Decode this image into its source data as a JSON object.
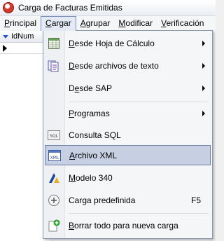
{
  "window": {
    "title": "Carga de Facturas Emitidas"
  },
  "menubar": [
    {
      "label": "Principal"
    },
    {
      "label": "Cargar"
    },
    {
      "label": "Agrupar"
    },
    {
      "label": "Modificar"
    },
    {
      "label": "Verificación"
    }
  ],
  "grid": {
    "column_header": "IdNum"
  },
  "menu": {
    "items": [
      {
        "pre": "",
        "u": "D",
        "post": "esde Hoja de Cálculo",
        "icon": "spreadsheet-icon",
        "has_submenu": true
      },
      {
        "pre": "",
        "u": "D",
        "post": "esde archivos de texto",
        "icon": "text-files-icon",
        "has_submenu": true
      },
      {
        "pre": "D",
        "u": "e",
        "post": "sde SAP",
        "icon": "",
        "has_submenu": true
      },
      {
        "pre": "",
        "u": "P",
        "post": "rogramas",
        "icon": "",
        "has_submenu": true
      },
      {
        "pre": "Consulta SQL",
        "u": "",
        "post": "",
        "icon": "sql-icon",
        "has_submenu": false
      },
      {
        "pre": "",
        "u": "A",
        "post": "rchivo XML",
        "icon": "xml-icon",
        "has_submenu": false,
        "highlighted": true
      },
      {
        "pre": "",
        "u": "M",
        "post": "odelo 340",
        "icon": "modelo-340-icon",
        "has_submenu": false
      },
      {
        "pre": "Carga predefinida",
        "u": "",
        "post": "",
        "icon": "add-circle-icon",
        "has_submenu": false,
        "shortcut": "F5"
      },
      {
        "pre": "",
        "u": "B",
        "post": "orrar todo para nueva carga",
        "icon": "new-document-icon",
        "has_submenu": false
      }
    ]
  }
}
